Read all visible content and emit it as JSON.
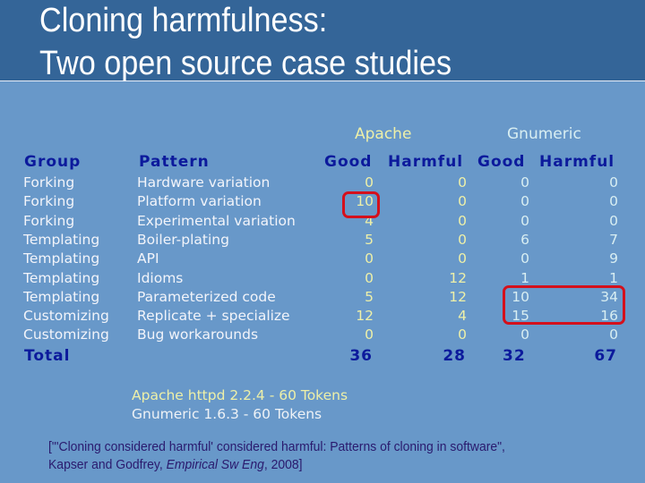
{
  "title": {
    "line1": "Cloning harmfulness:",
    "line2": "Two open source case studies"
  },
  "projects": {
    "apache": "Apache",
    "gnumeric": "Gnumeric"
  },
  "table": {
    "headers": {
      "group": "Group",
      "pattern": "Pattern",
      "apache_good": "Good",
      "apache_harmful": "Harmful",
      "gnumeric_good": "Good",
      "gnumeric_harmful": "Harmful"
    },
    "rows": [
      {
        "group": "Forking",
        "pattern": "Hardware variation",
        "ag": "0",
        "ah": "0",
        "gg": "0",
        "gh": "0"
      },
      {
        "group": "Forking",
        "pattern": "Platform variation",
        "ag": "10",
        "ah": "0",
        "gg": "0",
        "gh": "0"
      },
      {
        "group": "Forking",
        "pattern": "Experimental variation",
        "ag": "4",
        "ah": "0",
        "gg": "0",
        "gh": "0"
      },
      {
        "group": "Templating",
        "pattern": "Boiler-plating",
        "ag": "5",
        "ah": "0",
        "gg": "6",
        "gh": "7"
      },
      {
        "group": "Templating",
        "pattern": "API",
        "ag": "0",
        "ah": "0",
        "gg": "0",
        "gh": "9"
      },
      {
        "group": "Templating",
        "pattern": "Idioms",
        "ag": "0",
        "ah": "12",
        "gg": "1",
        "gh": "1"
      },
      {
        "group": "Templating",
        "pattern": "Parameterized code",
        "ag": "5",
        "ah": "12",
        "gg": "10",
        "gh": "34"
      },
      {
        "group": "Customizing",
        "pattern": "Replicate + specialize",
        "ag": "12",
        "ah": "4",
        "gg": "15",
        "gh": "16"
      },
      {
        "group": "Customizing",
        "pattern": "Bug workarounds",
        "ag": "0",
        "ah": "0",
        "gg": "0",
        "gh": "0"
      }
    ],
    "total": {
      "label": "Total",
      "ag": "36",
      "ah": "28",
      "gg": "32",
      "gh": "67"
    }
  },
  "info": {
    "apache": "Apache httpd 2.2.4 - 60 Tokens",
    "gnumeric": "Gnumeric 1.6.3 - 60 Tokens"
  },
  "citation": {
    "prefix": "[\"'Cloning considered harmful' considered harmful: Patterns of cloning in software\",",
    "authors": "Kapser and Godfrey, ",
    "venue": "Empirical Sw Eng",
    "year": ", 2008]"
  },
  "colors": {
    "background": "#6898c9",
    "titlebar": "#346598",
    "header": "#0c1a9c",
    "apache": "#eef0a8",
    "gnumeric": "#d8eef2",
    "highlight": "#d4101c",
    "citation": "#2a1a6e"
  }
}
